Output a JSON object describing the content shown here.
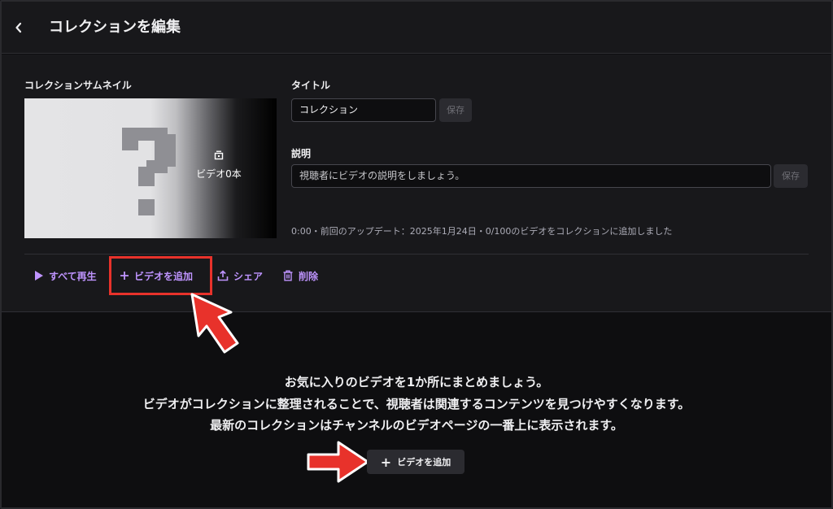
{
  "header": {
    "back_icon": "chevron-left-icon",
    "title": "コレクションを編集"
  },
  "thumbnail": {
    "label": "コレクションサムネイル",
    "video_count": "ビデオ0本",
    "placeholder_icon": "question-mark-icon",
    "count_icon": "stack-icon"
  },
  "title_field": {
    "label": "タイトル",
    "value": "コレクション",
    "save_label": "保存"
  },
  "description_field": {
    "label": "説明",
    "placeholder": "視聴者にビデオの説明をしましょう。",
    "save_label": "保存"
  },
  "meta": "0:00・前回のアップデート：2025年1月24日・0/100のビデオをコレクションに追加しました",
  "actions": [
    {
      "label": "すべて再生",
      "icon": "play-icon"
    },
    {
      "label": "ビデオを追加",
      "icon": "plus-icon"
    },
    {
      "label": "シェア",
      "icon": "share-icon"
    },
    {
      "label": "削除",
      "icon": "trash-icon"
    }
  ],
  "empty_state": {
    "line1": "お気に入りのビデオを1か所にまとめましょう。",
    "line2": "ビデオがコレクションに整理されることで、視聴者は関連するコンテンツを見つけやすくなります。",
    "line3": "最新のコレクションはチャンネルのビデオページの一番上に表示されます。",
    "add_button_label": "ビデオを追加"
  },
  "colors": {
    "background": "#0e0e10",
    "panel": "#18181b",
    "accent": "#bf94ff",
    "annotation": "#e8322b"
  }
}
